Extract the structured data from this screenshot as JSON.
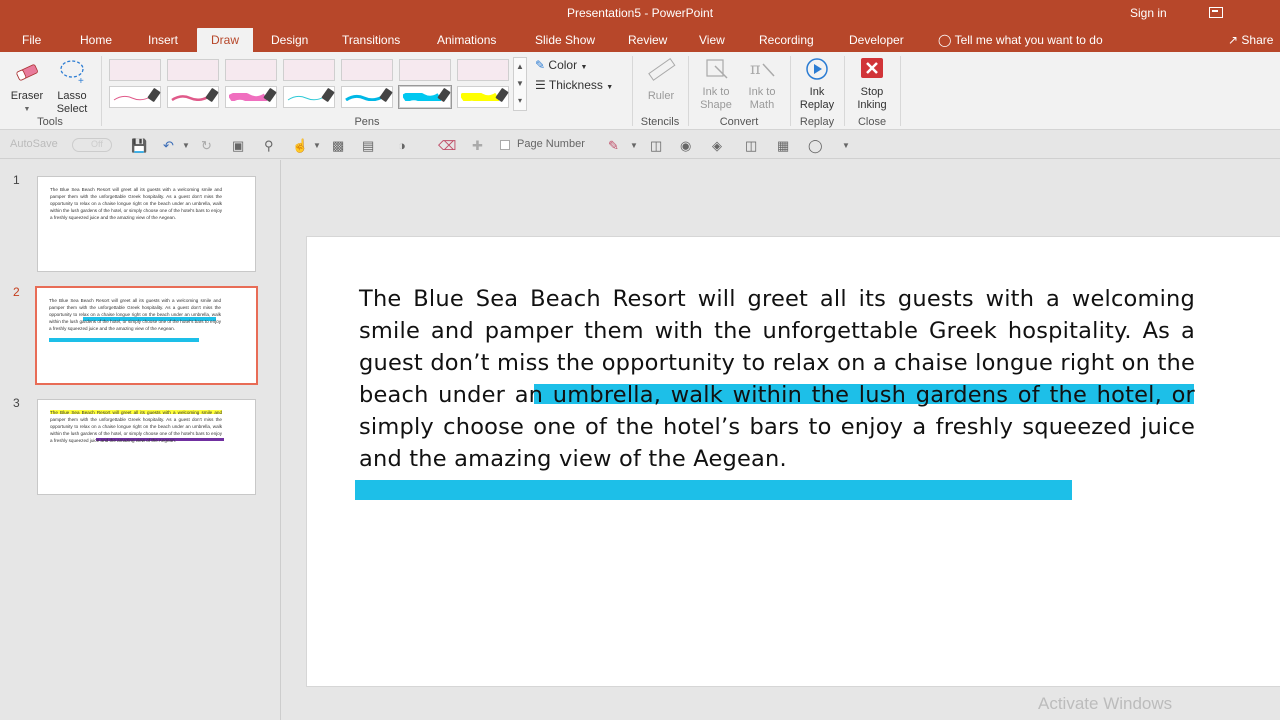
{
  "window": {
    "title": "Presentation5  -  PowerPoint",
    "sign_in": "Sign in"
  },
  "tabs": [
    "File",
    "Home",
    "Insert",
    "Draw",
    "Design",
    "Transitions",
    "Animations",
    "Slide Show",
    "Review",
    "View",
    "Recording",
    "Developer"
  ],
  "active_tab": "Draw",
  "tell_me": "Tell me what you want to do",
  "share": "Share",
  "ribbon": {
    "tools": {
      "eraser": "Eraser",
      "lasso": "Lasso",
      "lasso2": "Select",
      "group": "Tools"
    },
    "pens": {
      "group": "Pens",
      "colors": [
        "#e05a8a",
        "#e05a8a",
        "#f06fbf",
        "#2ec9d6",
        "#00b8e6",
        "#00c8f0",
        "#ffff00"
      ],
      "color_label": "Color",
      "thickness_label": "Thickness"
    },
    "stencils": {
      "ruler": "Ruler",
      "group": "Stencils"
    },
    "convert": {
      "ink_to_shape_1": "Ink to",
      "ink_to_shape_2": "Shape",
      "ink_to_math_1": "Ink to",
      "ink_to_math_2": "Math",
      "group": "Convert"
    },
    "replay": {
      "ink_replay_1": "Ink",
      "ink_replay_2": "Replay",
      "group": "Replay"
    },
    "close": {
      "stop_inking_1": "Stop",
      "stop_inking_2": "Inking",
      "group": "Close"
    }
  },
  "qat": {
    "autosave": "AutoSave",
    "autosave_state": "Off",
    "page_number": "Page Number"
  },
  "slides": [
    {
      "number": "1",
      "text": "The Blue Sea Beach Resort will greet all its guests with a welcoming smile and pamper them with the unforgettable Greek hospitality. As a guest don't miss the opportunity to relax on a chaise longue right on the beach under an umbrella, walk within the lush gardens of the hotel, or simply choose one of the hotel's bars to enjoy a freshly squeezed juice and the amazing view of the Aegean."
    },
    {
      "number": "2",
      "text": "The Blue Sea Beach Resort will greet all its guests with a welcoming smile and pamper them with the unforgettable Greek hospitality. As a guest don't miss the opportunity to relax on a chaise longue right on the beach under an umbrella, walk within the lush gardens of the hotel, or simply choose one of the hotel's bars to enjoy a freshly squeezed juice and the amazing view of the Aegean."
    },
    {
      "number": "3",
      "text": "The Blue Sea Beach Resort will greet all its guests with a welcoming smile and pamper them with the unforgettable Greek hospitality. As a guest don't miss the opportunity to relax on a chaise longue right on the beach under an umbrella, walk within the lush gardens of the hotel, or simply choose one of the hotel's bars to enjoy a freshly squeezed juice and the amazing view of the Aegean."
    }
  ],
  "selected_slide": "2",
  "main_slide": {
    "text": "The Blue Sea Beach Resort will greet all its guests with a welcoming smile and pamper them with the unforgettable Greek hospitality. As a guest don’t miss the opportunity to relax on a chaise longue right on the beach under an umbrella, walk within the lush gardens of the hotel, or simply choose one of the hotel’s bars to enjoy a freshly squeezed juice and the amazing view of the Aegean.",
    "highlight_color": "#1dbfe8"
  },
  "watermark": "Activate Windows"
}
